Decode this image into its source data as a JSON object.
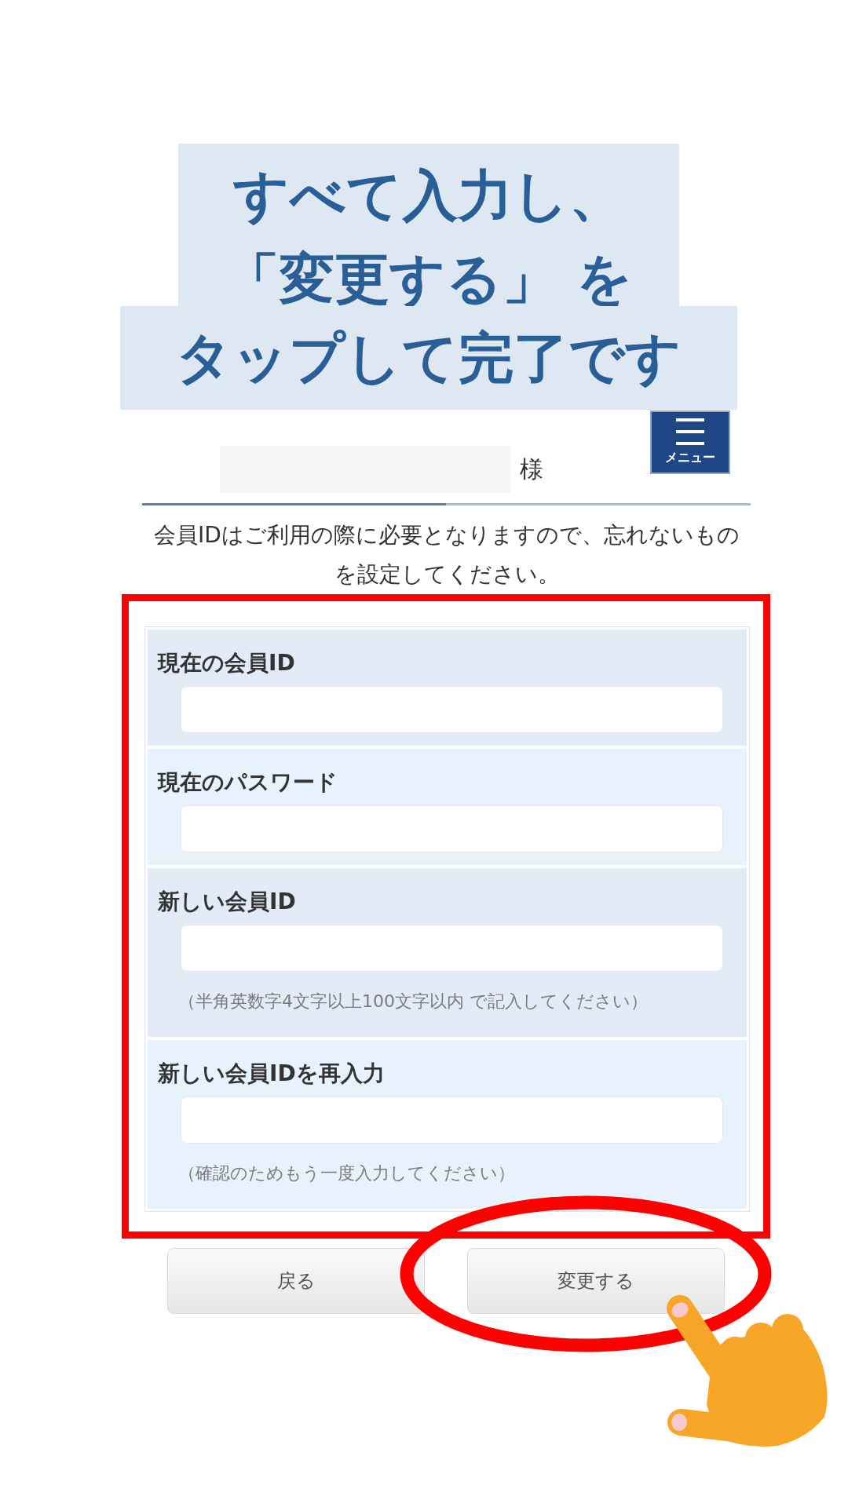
{
  "caption": {
    "lines": [
      "すべて入力し、",
      "「変更する」 を",
      "タップして完了です"
    ]
  },
  "header": {
    "greeting_suffix": "様",
    "menu_button": {
      "label": "メニュー"
    }
  },
  "intro": "会員IDはご利用の際に必要となりますので、忘れないものを設定してください。",
  "form": {
    "fields": [
      {
        "label": "現在の会員ID"
      },
      {
        "label": "現在のパスワード"
      },
      {
        "label": "新しい会員ID",
        "note": "（半角英数字4文字以上100文字以内 で記入してください）"
      },
      {
        "label": "新しい会員IDを再入力",
        "note": "（確認のためもう一度入力してください）"
      }
    ]
  },
  "buttons": [
    {
      "label": "戻る"
    },
    {
      "label": "変更する"
    }
  ]
}
